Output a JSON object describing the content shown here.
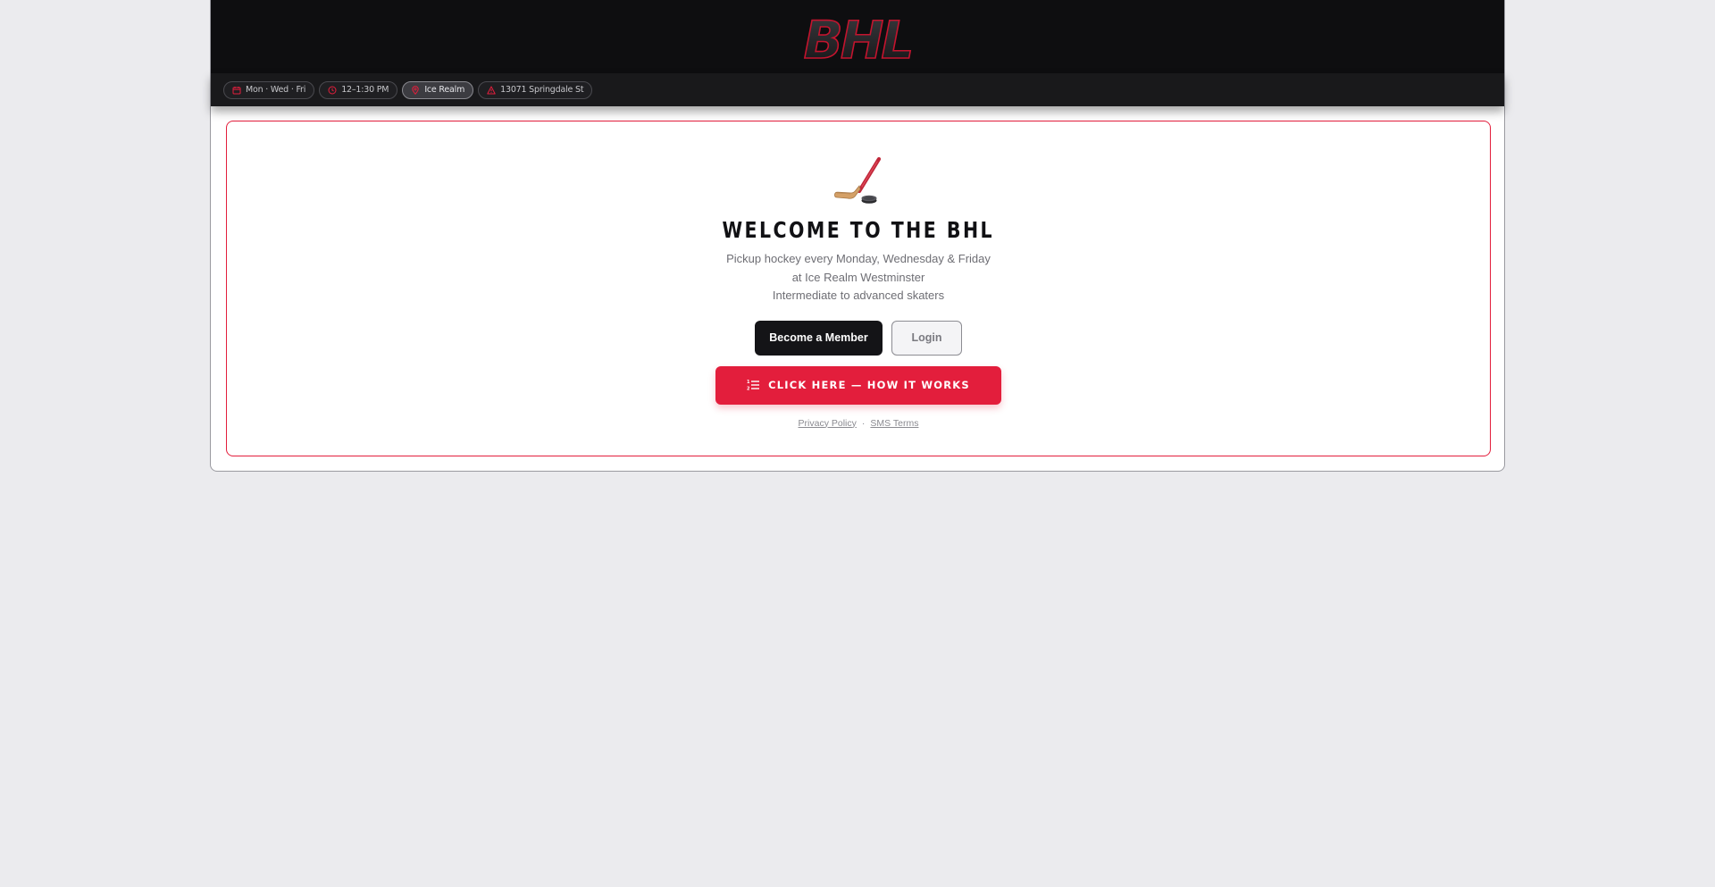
{
  "header": {
    "logo_text": "BHL"
  },
  "infobar": {
    "pills": [
      {
        "icon": "calendar-icon",
        "label": "Mon · Wed · Fri"
      },
      {
        "icon": "clock-icon",
        "label": "12–1:30 PM"
      },
      {
        "icon": "location-pin-icon",
        "label": "Ice Realm"
      },
      {
        "icon": "alert-triangle-icon",
        "label": "13071 Springdale St"
      }
    ]
  },
  "hero": {
    "icon": "hockey-stick-icon",
    "title": "WELCOME TO THE BHL",
    "lines": [
      "Pickup hockey every Monday, Wednesday & Friday",
      "at Ice Realm Westminster",
      "Intermediate to advanced skaters"
    ],
    "member_button": "Become a Member",
    "login_button": "Login",
    "how_button": "CLICK HERE — HOW IT WORKS",
    "privacy_link": "Privacy Policy",
    "separator": "·",
    "sms_link": "SMS Terms"
  },
  "colors": {
    "accent": "#e31e3c",
    "header_bg": "#0e0e10",
    "page_bg": "#ebebee"
  }
}
